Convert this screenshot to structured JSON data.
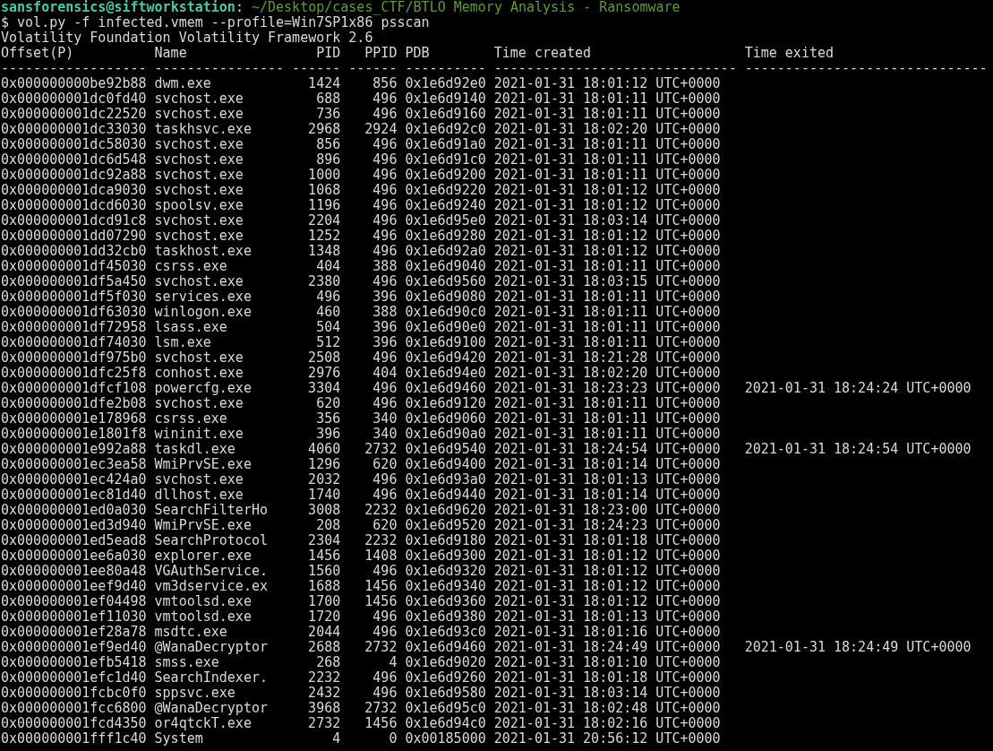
{
  "prompt": {
    "user_host": "sansforensics@siftworkstation",
    "separator": ":",
    "path": "~/Desktop/cases_CTF/BTLO Memory Analysis - Ransomware",
    "command": "$ vol.py -f infected.vmem --profile=Win7SP1x86 psscan"
  },
  "banner": "Volatility Foundation Volatility Framework 2.6",
  "table": {
    "columns": [
      {
        "label": "Offset(P)",
        "rule": "------------------"
      },
      {
        "label": "Name",
        "rule": "----------------"
      },
      {
        "label": "PID",
        "rule": "------"
      },
      {
        "label": "PPID",
        "rule": "------"
      },
      {
        "label": "PDB",
        "rule": "----------"
      },
      {
        "label": "Time created",
        "rule": "------------------------------"
      },
      {
        "label": "Time exited",
        "rule": "------------------------------"
      }
    ],
    "rows": [
      [
        "0x000000000be92b88",
        "dwm.exe",
        "1424",
        "856",
        "0x1e6d92e0",
        "2021-01-31 18:01:12 UTC+0000"
      ],
      [
        "0x000000001dc0fd40",
        "svchost.exe",
        "688",
        "496",
        "0x1e6d9140",
        "2021-01-31 18:01:11 UTC+0000"
      ],
      [
        "0x000000001dc22520",
        "svchost.exe",
        "736",
        "496",
        "0x1e6d9160",
        "2021-01-31 18:01:11 UTC+0000"
      ],
      [
        "0x000000001dc33030",
        "taskhsvc.exe",
        "2968",
        "2924",
        "0x1e6d92c0",
        "2021-01-31 18:02:20 UTC+0000"
      ],
      [
        "0x000000001dc58030",
        "svchost.exe",
        "856",
        "496",
        "0x1e6d91a0",
        "2021-01-31 18:01:11 UTC+0000"
      ],
      [
        "0x000000001dc6d548",
        "svchost.exe",
        "896",
        "496",
        "0x1e6d91c0",
        "2021-01-31 18:01:11 UTC+0000"
      ],
      [
        "0x000000001dc92a88",
        "svchost.exe",
        "1000",
        "496",
        "0x1e6d9200",
        "2021-01-31 18:01:11 UTC+0000"
      ],
      [
        "0x000000001dca9030",
        "svchost.exe",
        "1068",
        "496",
        "0x1e6d9220",
        "2021-01-31 18:01:12 UTC+0000"
      ],
      [
        "0x000000001dcd6030",
        "spoolsv.exe",
        "1196",
        "496",
        "0x1e6d9240",
        "2021-01-31 18:01:12 UTC+0000"
      ],
      [
        "0x000000001dcd91c8",
        "svchost.exe",
        "2204",
        "496",
        "0x1e6d95e0",
        "2021-01-31 18:03:14 UTC+0000"
      ],
      [
        "0x000000001dd07290",
        "svchost.exe",
        "1252",
        "496",
        "0x1e6d9280",
        "2021-01-31 18:01:12 UTC+0000"
      ],
      [
        "0x000000001dd32cb0",
        "taskhost.exe",
        "1348",
        "496",
        "0x1e6d92a0",
        "2021-01-31 18:01:12 UTC+0000"
      ],
      [
        "0x000000001df45030",
        "csrss.exe",
        "404",
        "388",
        "0x1e6d9040",
        "2021-01-31 18:01:11 UTC+0000"
      ],
      [
        "0x000000001df5a450",
        "svchost.exe",
        "2380",
        "496",
        "0x1e6d9560",
        "2021-01-31 18:03:15 UTC+0000"
      ],
      [
        "0x000000001df5f030",
        "services.exe",
        "496",
        "396",
        "0x1e6d9080",
        "2021-01-31 18:01:11 UTC+0000"
      ],
      [
        "0x000000001df63030",
        "winlogon.exe",
        "460",
        "388",
        "0x1e6d90c0",
        "2021-01-31 18:01:11 UTC+0000"
      ],
      [
        "0x000000001df72958",
        "lsass.exe",
        "504",
        "396",
        "0x1e6d90e0",
        "2021-01-31 18:01:11 UTC+0000"
      ],
      [
        "0x000000001df74030",
        "lsm.exe",
        "512",
        "396",
        "0x1e6d9100",
        "2021-01-31 18:01:11 UTC+0000"
      ],
      [
        "0x000000001df975b0",
        "svchost.exe",
        "2508",
        "496",
        "0x1e6d9420",
        "2021-01-31 18:21:28 UTC+0000"
      ],
      [
        "0x000000001dfc25f8",
        "conhost.exe",
        "2976",
        "404",
        "0x1e6d94e0",
        "2021-01-31 18:02:20 UTC+0000"
      ],
      [
        "0x000000001dfcf108",
        "powercfg.exe",
        "3304",
        "496",
        "0x1e6d9460",
        "2021-01-31 18:23:23 UTC+0000",
        "2021-01-31 18:24:24 UTC+0000"
      ],
      [
        "0x000000001dfe2b08",
        "svchost.exe",
        "620",
        "496",
        "0x1e6d9120",
        "2021-01-31 18:01:11 UTC+0000"
      ],
      [
        "0x000000001e178968",
        "csrss.exe",
        "356",
        "340",
        "0x1e6d9060",
        "2021-01-31 18:01:11 UTC+0000"
      ],
      [
        "0x000000001e1801f8",
        "wininit.exe",
        "396",
        "340",
        "0x1e6d90a0",
        "2021-01-31 18:01:11 UTC+0000"
      ],
      [
        "0x000000001e992a88",
        "taskdl.exe",
        "4060",
        "2732",
        "0x1e6d9540",
        "2021-01-31 18:24:54 UTC+0000",
        "2021-01-31 18:24:54 UTC+0000"
      ],
      [
        "0x000000001ec3ea58",
        "WmiPrvSE.exe",
        "1296",
        "620",
        "0x1e6d9400",
        "2021-01-31 18:01:14 UTC+0000"
      ],
      [
        "0x000000001ec424a0",
        "svchost.exe",
        "2032",
        "496",
        "0x1e6d93a0",
        "2021-01-31 18:01:13 UTC+0000"
      ],
      [
        "0x000000001ec81d40",
        "dllhost.exe",
        "1740",
        "496",
        "0x1e6d9440",
        "2021-01-31 18:01:14 UTC+0000"
      ],
      [
        "0x000000001ed0a030",
        "SearchFilterHo",
        "3008",
        "2232",
        "0x1e6d9620",
        "2021-01-31 18:23:00 UTC+0000"
      ],
      [
        "0x000000001ed3d940",
        "WmiPrvSE.exe",
        "208",
        "620",
        "0x1e6d9520",
        "2021-01-31 18:24:23 UTC+0000"
      ],
      [
        "0x000000001ed5ead8",
        "SearchProtocol",
        "2304",
        "2232",
        "0x1e6d9180",
        "2021-01-31 18:01:18 UTC+0000"
      ],
      [
        "0x000000001ee6a030",
        "explorer.exe",
        "1456",
        "1408",
        "0x1e6d9300",
        "2021-01-31 18:01:12 UTC+0000"
      ],
      [
        "0x000000001ee80a48",
        "VGAuthService.",
        "1560",
        "496",
        "0x1e6d9320",
        "2021-01-31 18:01:12 UTC+0000"
      ],
      [
        "0x000000001eef9d40",
        "vm3dservice.ex",
        "1688",
        "1456",
        "0x1e6d9340",
        "2021-01-31 18:01:12 UTC+0000"
      ],
      [
        "0x000000001ef04498",
        "vmtoolsd.exe",
        "1700",
        "1456",
        "0x1e6d9360",
        "2021-01-31 18:01:12 UTC+0000"
      ],
      [
        "0x000000001ef11030",
        "vmtoolsd.exe",
        "1720",
        "496",
        "0x1e6d9380",
        "2021-01-31 18:01:13 UTC+0000"
      ],
      [
        "0x000000001ef28a78",
        "msdtc.exe",
        "2044",
        "496",
        "0x1e6d93c0",
        "2021-01-31 18:01:16 UTC+0000"
      ],
      [
        "0x000000001ef9ed40",
        "@WanaDecryptor",
        "2688",
        "2732",
        "0x1e6d9460",
        "2021-01-31 18:24:49 UTC+0000",
        "2021-01-31 18:24:49 UTC+0000"
      ],
      [
        "0x000000001efb5418",
        "smss.exe",
        "268",
        "4",
        "0x1e6d9020",
        "2021-01-31 18:01:10 UTC+0000"
      ],
      [
        "0x000000001efc1d40",
        "SearchIndexer.",
        "2232",
        "496",
        "0x1e6d9260",
        "2021-01-31 18:01:18 UTC+0000"
      ],
      [
        "0x000000001fcbc0f0",
        "sppsvc.exe",
        "2432",
        "496",
        "0x1e6d9580",
        "2021-01-31 18:03:14 UTC+0000"
      ],
      [
        "0x000000001fcc6800",
        "@WanaDecryptor",
        "3968",
        "2732",
        "0x1e6d95c0",
        "2021-01-31 18:02:48 UTC+0000"
      ],
      [
        "0x000000001fcd4350",
        "or4qtckT.exe",
        "2732",
        "1456",
        "0x1e6d94c0",
        "2021-01-31 18:02:16 UTC+0000"
      ],
      [
        "0x000000001fff1c40",
        "System",
        "4",
        "0",
        "0x00185000",
        "2021-01-31 20:56:12 UTC+0000"
      ]
    ]
  }
}
